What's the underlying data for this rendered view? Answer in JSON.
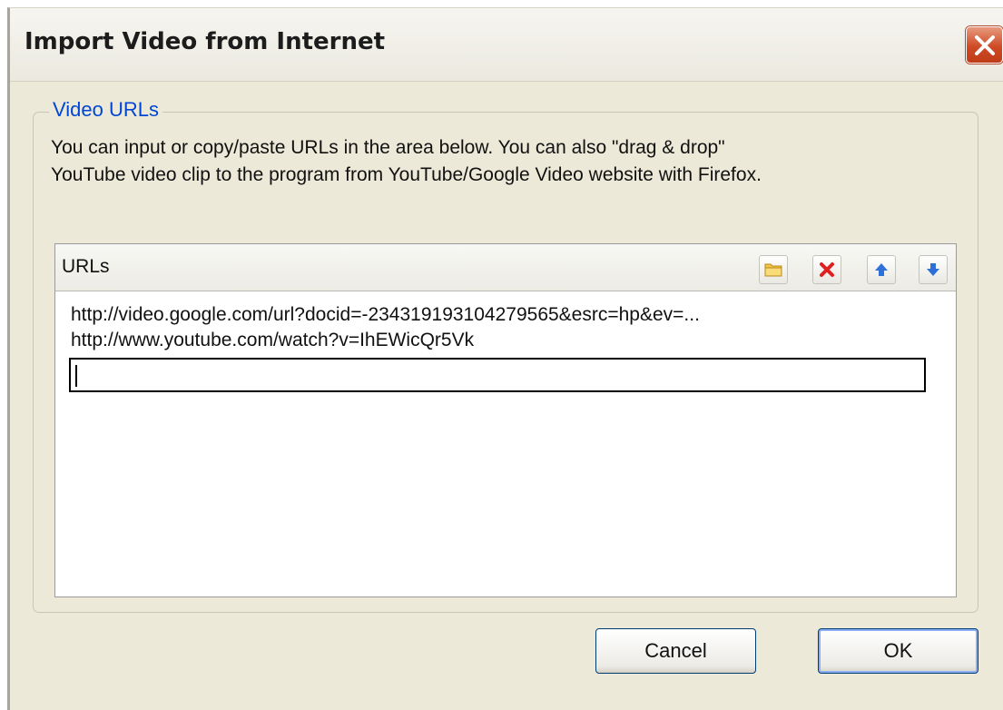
{
  "dialog": {
    "title": "Import Video from Internet"
  },
  "group": {
    "label": "Video URLs",
    "description_lines": [
      "You can input or copy/paste URLs in the area below. You can also \"drag & drop\"",
      "YouTube video clip to the program from YouTube/Google Video website with Firefox."
    ]
  },
  "urls_panel": {
    "header": "URLs",
    "toolbar": {
      "open": {
        "icon": "folder-icon"
      },
      "delete": {
        "icon": "delete-x-icon"
      },
      "move_up": {
        "icon": "arrow-up-icon"
      },
      "move_down": {
        "icon": "arrow-down-icon"
      }
    },
    "items": [
      "http://video.google.com/url?docid=-234319193104279565&esrc=hp&ev=...",
      "http://www.youtube.com/watch?v=IhEWicQr5Vk"
    ],
    "new_entry_value": ""
  },
  "buttons": {
    "cancel": "Cancel",
    "ok": "OK"
  },
  "colors": {
    "dialog_bg": "#ece9d8",
    "group_label": "#0046d5",
    "close_button": "#cf4b26",
    "arrow_blue": "#2f6fd8",
    "delete_red": "#e02020"
  }
}
